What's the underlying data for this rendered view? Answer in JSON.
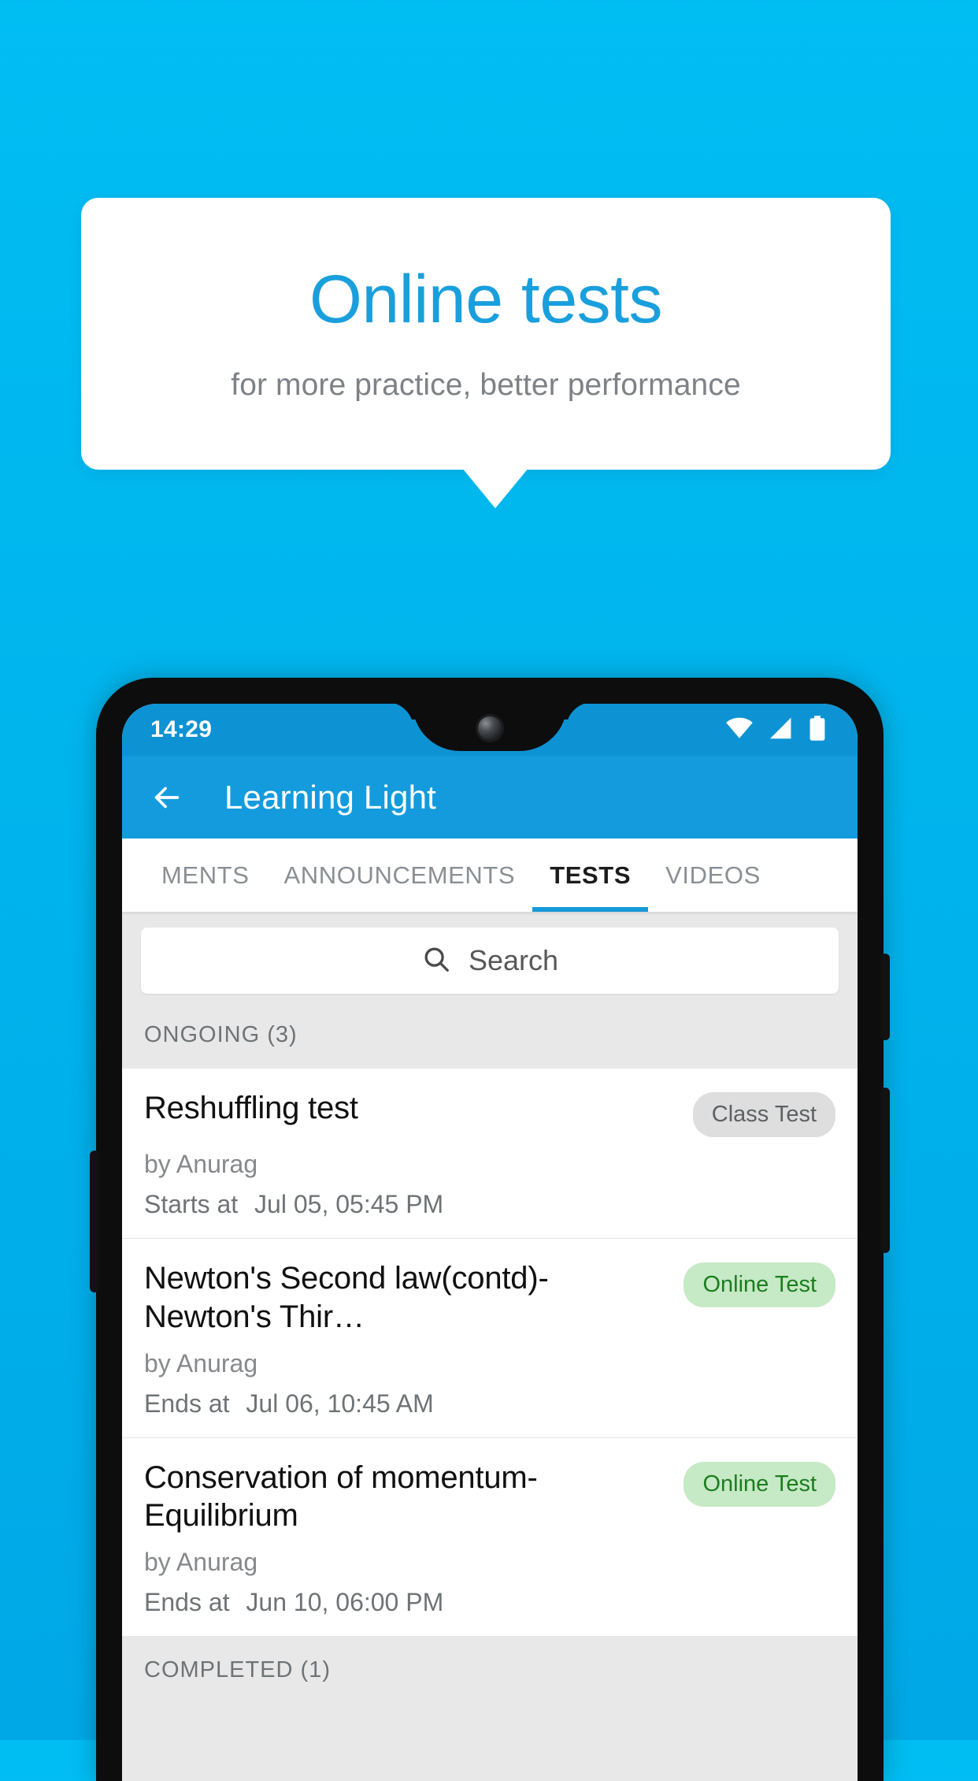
{
  "promo": {
    "title": "Online tests",
    "subtitle": "for more practice, better performance",
    "accent_color": "#1a9fdd",
    "background_color": "#00b4ec"
  },
  "phone": {
    "status_bar": {
      "time": "14:29",
      "icons": [
        "wifi-icon",
        "signal-icon",
        "battery-icon"
      ],
      "background_color": "#0d93d4"
    },
    "app_bar": {
      "back_icon": "back-arrow-icon",
      "title": "Learning Light",
      "background_color": "#149bdd"
    },
    "tabs": [
      {
        "label": "MENTS",
        "active": false
      },
      {
        "label": "ANNOUNCEMENTS",
        "active": false
      },
      {
        "label": "TESTS",
        "active": true
      },
      {
        "label": "VIDEOS",
        "active": false
      }
    ],
    "search": {
      "icon": "search-icon",
      "placeholder": "Search",
      "value": ""
    },
    "sections": [
      {
        "header": "ONGOING (3)",
        "items": [
          {
            "title": "Reshuffling test",
            "badge": "Class Test",
            "badge_type": "class",
            "badge_color": "#dedede",
            "author": "by Anurag",
            "date_label": "Starts at",
            "date_value": "Jul 05, 05:45 PM"
          },
          {
            "title": "Newton's Second law(contd)-Newton's Thir…",
            "badge": "Online Test",
            "badge_type": "online",
            "badge_color": "#c6e9c6",
            "author": "by Anurag",
            "date_label": "Ends at",
            "date_value": "Jul 06, 10:45 AM"
          },
          {
            "title": "Conservation of momentum-Equilibrium",
            "badge": "Online Test",
            "badge_type": "online",
            "badge_color": "#c6e9c6",
            "author": "by Anurag",
            "date_label": "Ends at",
            "date_value": "Jun 10, 06:00 PM"
          }
        ]
      },
      {
        "header": "COMPLETED (1)",
        "items": []
      }
    ]
  }
}
